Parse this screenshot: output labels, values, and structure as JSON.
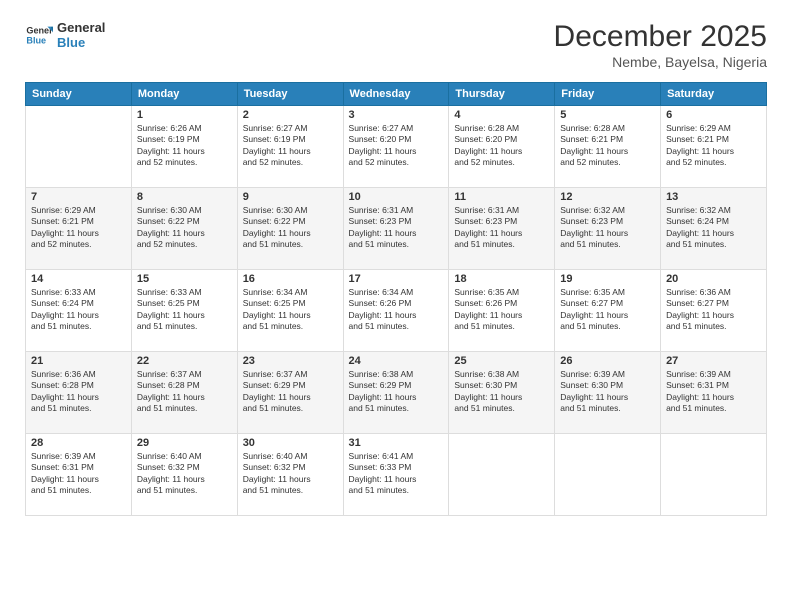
{
  "header": {
    "logo_line1": "General",
    "logo_line2": "Blue",
    "month": "December 2025",
    "location": "Nembe, Bayelsa, Nigeria"
  },
  "days_of_week": [
    "Sunday",
    "Monday",
    "Tuesday",
    "Wednesday",
    "Thursday",
    "Friday",
    "Saturday"
  ],
  "weeks": [
    [
      {
        "day": "",
        "info": ""
      },
      {
        "day": "1",
        "info": "Sunrise: 6:26 AM\nSunset: 6:19 PM\nDaylight: 11 hours\nand 52 minutes."
      },
      {
        "day": "2",
        "info": "Sunrise: 6:27 AM\nSunset: 6:19 PM\nDaylight: 11 hours\nand 52 minutes."
      },
      {
        "day": "3",
        "info": "Sunrise: 6:27 AM\nSunset: 6:20 PM\nDaylight: 11 hours\nand 52 minutes."
      },
      {
        "day": "4",
        "info": "Sunrise: 6:28 AM\nSunset: 6:20 PM\nDaylight: 11 hours\nand 52 minutes."
      },
      {
        "day": "5",
        "info": "Sunrise: 6:28 AM\nSunset: 6:21 PM\nDaylight: 11 hours\nand 52 minutes."
      },
      {
        "day": "6",
        "info": "Sunrise: 6:29 AM\nSunset: 6:21 PM\nDaylight: 11 hours\nand 52 minutes."
      }
    ],
    [
      {
        "day": "7",
        "info": "Sunrise: 6:29 AM\nSunset: 6:21 PM\nDaylight: 11 hours\nand 52 minutes."
      },
      {
        "day": "8",
        "info": "Sunrise: 6:30 AM\nSunset: 6:22 PM\nDaylight: 11 hours\nand 52 minutes."
      },
      {
        "day": "9",
        "info": "Sunrise: 6:30 AM\nSunset: 6:22 PM\nDaylight: 11 hours\nand 51 minutes."
      },
      {
        "day": "10",
        "info": "Sunrise: 6:31 AM\nSunset: 6:23 PM\nDaylight: 11 hours\nand 51 minutes."
      },
      {
        "day": "11",
        "info": "Sunrise: 6:31 AM\nSunset: 6:23 PM\nDaylight: 11 hours\nand 51 minutes."
      },
      {
        "day": "12",
        "info": "Sunrise: 6:32 AM\nSunset: 6:23 PM\nDaylight: 11 hours\nand 51 minutes."
      },
      {
        "day": "13",
        "info": "Sunrise: 6:32 AM\nSunset: 6:24 PM\nDaylight: 11 hours\nand 51 minutes."
      }
    ],
    [
      {
        "day": "14",
        "info": "Sunrise: 6:33 AM\nSunset: 6:24 PM\nDaylight: 11 hours\nand 51 minutes."
      },
      {
        "day": "15",
        "info": "Sunrise: 6:33 AM\nSunset: 6:25 PM\nDaylight: 11 hours\nand 51 minutes."
      },
      {
        "day": "16",
        "info": "Sunrise: 6:34 AM\nSunset: 6:25 PM\nDaylight: 11 hours\nand 51 minutes."
      },
      {
        "day": "17",
        "info": "Sunrise: 6:34 AM\nSunset: 6:26 PM\nDaylight: 11 hours\nand 51 minutes."
      },
      {
        "day": "18",
        "info": "Sunrise: 6:35 AM\nSunset: 6:26 PM\nDaylight: 11 hours\nand 51 minutes."
      },
      {
        "day": "19",
        "info": "Sunrise: 6:35 AM\nSunset: 6:27 PM\nDaylight: 11 hours\nand 51 minutes."
      },
      {
        "day": "20",
        "info": "Sunrise: 6:36 AM\nSunset: 6:27 PM\nDaylight: 11 hours\nand 51 minutes."
      }
    ],
    [
      {
        "day": "21",
        "info": "Sunrise: 6:36 AM\nSunset: 6:28 PM\nDaylight: 11 hours\nand 51 minutes."
      },
      {
        "day": "22",
        "info": "Sunrise: 6:37 AM\nSunset: 6:28 PM\nDaylight: 11 hours\nand 51 minutes."
      },
      {
        "day": "23",
        "info": "Sunrise: 6:37 AM\nSunset: 6:29 PM\nDaylight: 11 hours\nand 51 minutes."
      },
      {
        "day": "24",
        "info": "Sunrise: 6:38 AM\nSunset: 6:29 PM\nDaylight: 11 hours\nand 51 minutes."
      },
      {
        "day": "25",
        "info": "Sunrise: 6:38 AM\nSunset: 6:30 PM\nDaylight: 11 hours\nand 51 minutes."
      },
      {
        "day": "26",
        "info": "Sunrise: 6:39 AM\nSunset: 6:30 PM\nDaylight: 11 hours\nand 51 minutes."
      },
      {
        "day": "27",
        "info": "Sunrise: 6:39 AM\nSunset: 6:31 PM\nDaylight: 11 hours\nand 51 minutes."
      }
    ],
    [
      {
        "day": "28",
        "info": "Sunrise: 6:39 AM\nSunset: 6:31 PM\nDaylight: 11 hours\nand 51 minutes."
      },
      {
        "day": "29",
        "info": "Sunrise: 6:40 AM\nSunset: 6:32 PM\nDaylight: 11 hours\nand 51 minutes."
      },
      {
        "day": "30",
        "info": "Sunrise: 6:40 AM\nSunset: 6:32 PM\nDaylight: 11 hours\nand 51 minutes."
      },
      {
        "day": "31",
        "info": "Sunrise: 6:41 AM\nSunset: 6:33 PM\nDaylight: 11 hours\nand 51 minutes."
      },
      {
        "day": "",
        "info": ""
      },
      {
        "day": "",
        "info": ""
      },
      {
        "day": "",
        "info": ""
      }
    ]
  ]
}
